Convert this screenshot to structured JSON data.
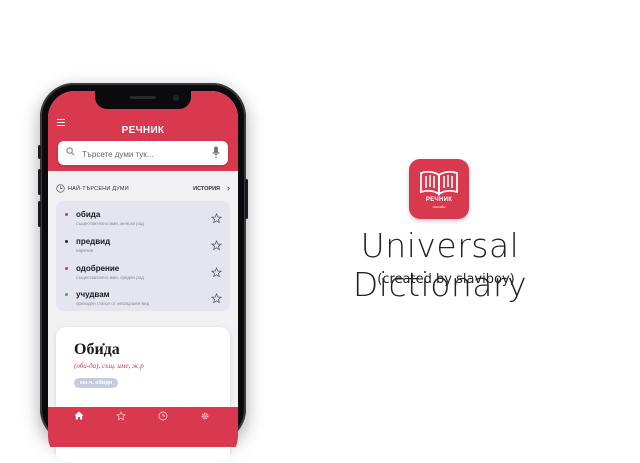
{
  "phone": {
    "header_title": "РЕЧНИК",
    "search": {
      "placeholder": "Търсете думи тук..."
    },
    "recent": {
      "label": "НАЙ-ТЪРСЕНИ ДУМИ",
      "history_label": "ИСТОРИЯ"
    },
    "words": [
      {
        "word": "обида",
        "desc": "съществително име, женски род",
        "dot": "#d8394f"
      },
      {
        "word": "предвид",
        "desc": "наречие",
        "dot": "#2b2b2b"
      },
      {
        "word": "одобрение",
        "desc": "съществително име, среден род",
        "dot": "#d8394f"
      },
      {
        "word": "учудвам",
        "desc": "преходен глагол от несвършен вид",
        "dot": "#3bb54a"
      }
    ],
    "card": {
      "word": "Оби̇да",
      "grammar": "(оби-да), същ. име, ж.р",
      "tag": "мн.ч. обиди"
    },
    "tabs": [
      "home-icon",
      "star-icon",
      "clock-icon",
      "gear-icon"
    ]
  },
  "app": {
    "icon_text": "РЕЧНИК",
    "icon_subtext": "ОНЛАЙН",
    "title": "Universal Dictionary",
    "credit": "(created by slaviboy)"
  },
  "colors": {
    "accent": "#d8394f",
    "list_bg": "#e4e5ee"
  }
}
